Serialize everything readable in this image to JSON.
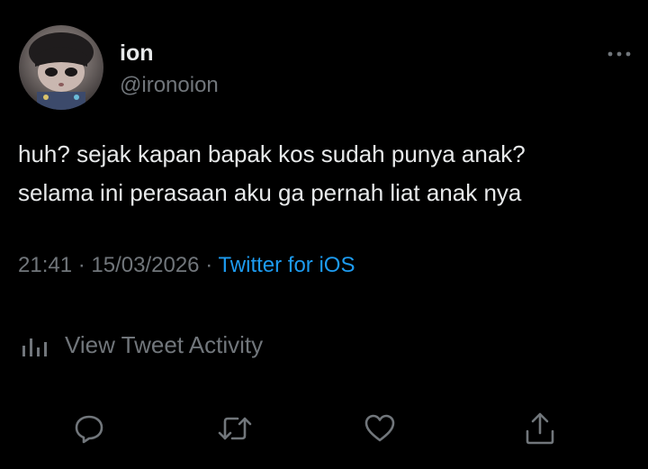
{
  "tweet": {
    "author": {
      "display_name": "ion",
      "handle": "@ironoion",
      "avatar_icon": "avatar-image"
    },
    "text": "huh? sejak kapan bapak kos sudah punya anak?\nselama ini perasaan aku ga pernah liat anak nya",
    "time": "21:41",
    "separator": "·",
    "date": "15/03/2026",
    "source": "Twitter for iOS",
    "activity_label": "View Tweet Activity"
  },
  "actions": {
    "reply_icon": "reply-icon",
    "retweet_icon": "retweet-icon",
    "like_icon": "heart-icon",
    "share_icon": "share-icon"
  },
  "colors": {
    "background": "#000000",
    "text": "#e7e9ea",
    "muted": "#71767b",
    "link": "#1d9bf0"
  }
}
